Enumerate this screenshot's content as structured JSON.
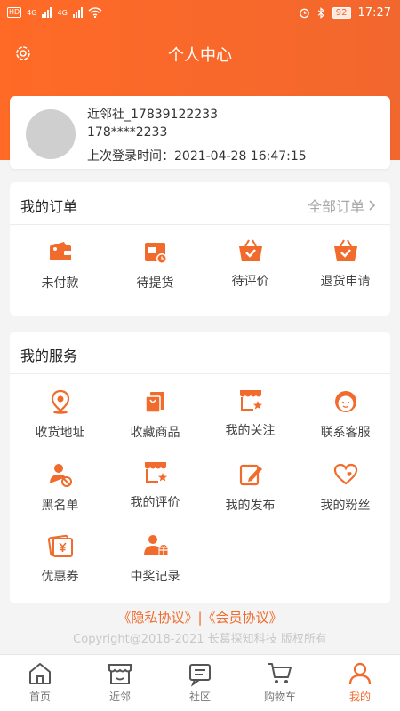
{
  "status_bar": {
    "left_tags": [
      "HD",
      "4G",
      "4G",
      "HD"
    ],
    "battery": "92",
    "time": "17:27"
  },
  "header": {
    "title": "个人中心",
    "settings_icon": "gear-icon"
  },
  "profile": {
    "name_line": "近邻社_17839122233",
    "phone": "178****2233",
    "last_login": "上次登录时间：2021-04-28 16:47:15"
  },
  "orders": {
    "title": "我的订单",
    "all_link": "全部订单",
    "items": [
      {
        "label": "未付款",
        "icon": "wallet-icon"
      },
      {
        "label": "待提货",
        "icon": "pickup-box-icon"
      },
      {
        "label": "待评价",
        "icon": "basket-check-icon"
      },
      {
        "label": "退货申请",
        "icon": "basket-return-icon"
      }
    ]
  },
  "services": {
    "title": "我的服务",
    "items": [
      {
        "label": "收货地址",
        "icon": "location-pin-icon"
      },
      {
        "label": "收藏商品",
        "icon": "bag-icon"
      },
      {
        "label": "我的关注",
        "icon": "shop-star-icon"
      },
      {
        "label": "联系客服",
        "icon": "customer-service-icon"
      },
      {
        "label": "黑名单",
        "icon": "block-user-icon"
      },
      {
        "label": "我的评价",
        "icon": "shop-review-icon"
      },
      {
        "label": "我的发布",
        "icon": "edit-icon"
      },
      {
        "label": "我的粉丝",
        "icon": "heart-icon"
      },
      {
        "label": "优惠券",
        "icon": "coupon-icon"
      },
      {
        "label": "中奖记录",
        "icon": "prize-user-icon"
      }
    ]
  },
  "footer": {
    "privacy": "《隐私协议》",
    "separator": "|",
    "member": "《会员协议》",
    "copyright": "Copyright@2018-2021 长葛探知科技 版权所有"
  },
  "tabbar": {
    "active": "我的",
    "items": [
      {
        "label": "首页",
        "icon": "home-icon"
      },
      {
        "label": "近邻",
        "icon": "store-icon"
      },
      {
        "label": "社区",
        "icon": "community-icon"
      },
      {
        "label": "购物车",
        "icon": "cart-icon"
      },
      {
        "label": "我的",
        "icon": "user-icon"
      }
    ]
  },
  "colors": {
    "accent": "#f06b2c",
    "header_start": "#ff6a26",
    "header_end": "#f2672e"
  }
}
